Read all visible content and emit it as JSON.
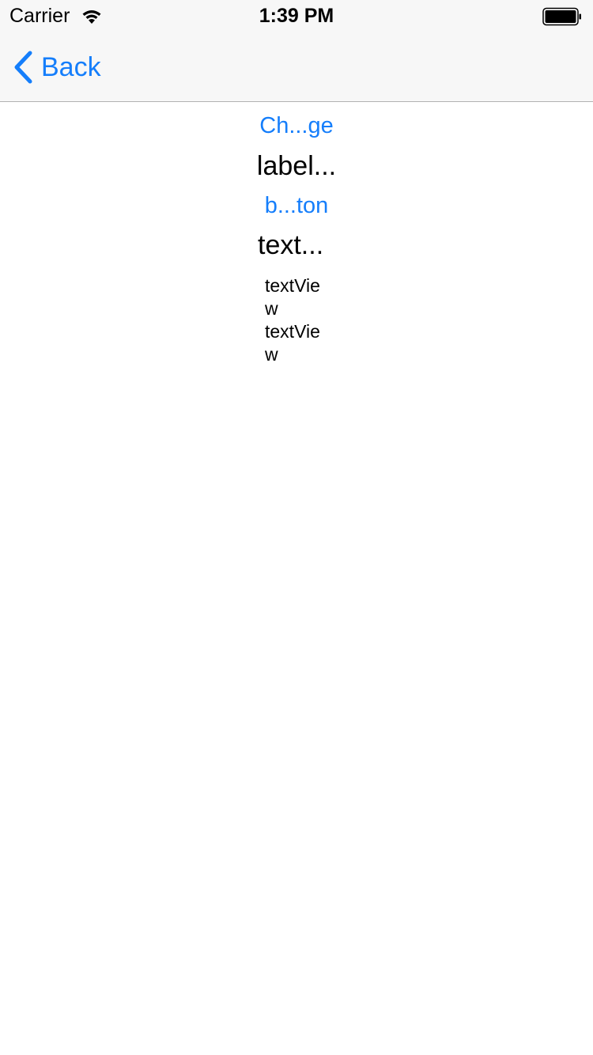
{
  "status_bar": {
    "carrier": "Carrier",
    "time": "1:39 PM",
    "wifi_icon": "wifi-icon",
    "battery_icon": "battery-icon"
  },
  "nav": {
    "back_label": "Back",
    "back_icon": "chevron-left-icon",
    "accent_color": "#157efb"
  },
  "content": {
    "change_button_label": "Ch...ge",
    "label_text": "label...",
    "button_label": "b...ton",
    "text_field_value": "text...",
    "text_view_lines": [
      "textVie",
      "w",
      "textVie",
      "w"
    ]
  }
}
